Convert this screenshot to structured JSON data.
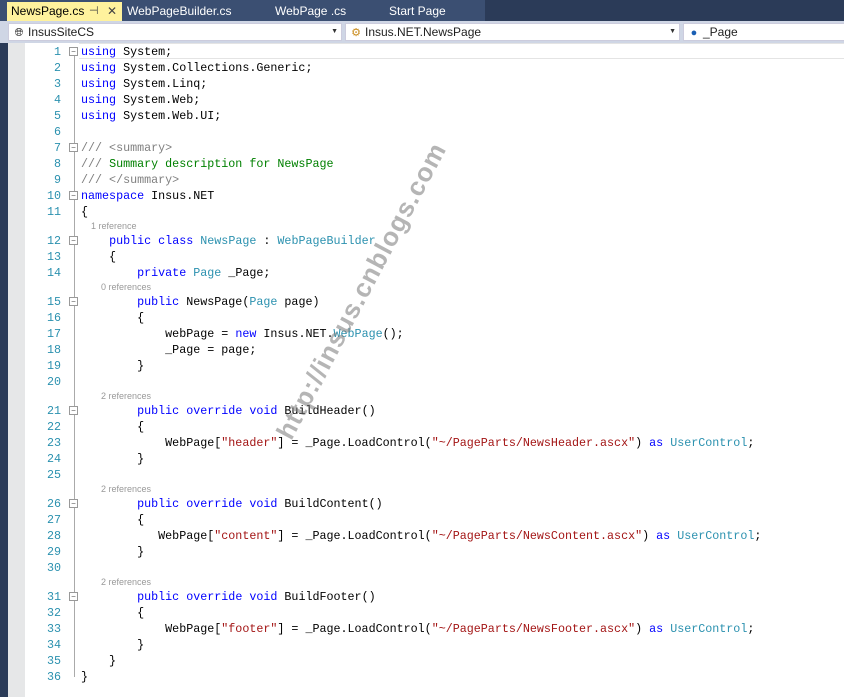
{
  "tabs": [
    {
      "label": "NewsPage.cs",
      "active": true
    },
    {
      "label": "WebPageBuilder.cs"
    },
    {
      "label": "WebPage .cs"
    },
    {
      "label": "Start Page"
    }
  ],
  "tab_pin_icon": "⊣",
  "tab_close_icon": "✕",
  "navbar": {
    "project": "InsusSiteCS",
    "type": "Insus.NET.NewsPage",
    "member": "_Page"
  },
  "watermark": "http://insus.cnblogs.com",
  "colors": {
    "keyword": "#0000ff",
    "type": "#2b91af",
    "string": "#a31515",
    "comment": "#008000",
    "doc": "#808080"
  },
  "lines": [
    {
      "n": "1",
      "fold": true,
      "tokens": [
        [
          "k",
          "using"
        ],
        [
          "p",
          " System;"
        ]
      ]
    },
    {
      "n": "2",
      "tokens": [
        [
          "k",
          "using"
        ],
        [
          "p",
          " System.Collections.Generic;"
        ]
      ]
    },
    {
      "n": "3",
      "tokens": [
        [
          "k",
          "using"
        ],
        [
          "p",
          " System.Linq;"
        ]
      ]
    },
    {
      "n": "4",
      "tokens": [
        [
          "k",
          "using"
        ],
        [
          "p",
          " System.Web;"
        ]
      ]
    },
    {
      "n": "5",
      "tokens": [
        [
          "k",
          "using"
        ],
        [
          "p",
          " System.Web.UI;"
        ]
      ]
    },
    {
      "n": "6",
      "tokens": []
    },
    {
      "n": "7",
      "fold": true,
      "tokens": [
        [
          "d",
          "/// <summary>"
        ]
      ]
    },
    {
      "n": "8",
      "tokens": [
        [
          "d",
          "/// "
        ],
        [
          "c",
          "Summary description for NewsPage"
        ]
      ]
    },
    {
      "n": "9",
      "tokens": [
        [
          "d",
          "/// </summary>"
        ]
      ]
    },
    {
      "n": "10",
      "fold": true,
      "tokens": [
        [
          "k",
          "namespace"
        ],
        [
          "p",
          " Insus.NET"
        ]
      ]
    },
    {
      "n": "11",
      "tokens": [
        [
          "p",
          "{"
        ]
      ]
    },
    {
      "lens": "    1 reference"
    },
    {
      "n": "12",
      "fold": true,
      "tokens": [
        [
          "p",
          "    "
        ],
        [
          "k",
          "public"
        ],
        [
          "p",
          " "
        ],
        [
          "k",
          "class"
        ],
        [
          "p",
          " "
        ],
        [
          "t",
          "NewsPage"
        ],
        [
          "p",
          " : "
        ],
        [
          "t",
          "WebPageBuilder"
        ]
      ]
    },
    {
      "n": "13",
      "tokens": [
        [
          "p",
          "    {"
        ]
      ]
    },
    {
      "n": "14",
      "tokens": [
        [
          "p",
          "        "
        ],
        [
          "k",
          "private"
        ],
        [
          "p",
          " "
        ],
        [
          "t",
          "Page"
        ],
        [
          "p",
          " _Page;"
        ]
      ]
    },
    {
      "lens": "        0 references"
    },
    {
      "n": "15",
      "fold": true,
      "tokens": [
        [
          "p",
          "        "
        ],
        [
          "k",
          "public"
        ],
        [
          "p",
          " NewsPage("
        ],
        [
          "t",
          "Page"
        ],
        [
          "p",
          " page)"
        ]
      ]
    },
    {
      "n": "16",
      "tokens": [
        [
          "p",
          "        {"
        ]
      ]
    },
    {
      "n": "17",
      "tokens": [
        [
          "p",
          "            webPage = "
        ],
        [
          "k",
          "new"
        ],
        [
          "p",
          " Insus.NET."
        ],
        [
          "t",
          "WebPage"
        ],
        [
          "p",
          "();"
        ]
      ]
    },
    {
      "n": "18",
      "tokens": [
        [
          "p",
          "            _Page = page;"
        ]
      ]
    },
    {
      "n": "19",
      "tokens": [
        [
          "p",
          "        }"
        ]
      ]
    },
    {
      "n": "20",
      "tokens": []
    },
    {
      "lens": "        2 references"
    },
    {
      "n": "21",
      "fold": true,
      "tokens": [
        [
          "p",
          "        "
        ],
        [
          "k",
          "public"
        ],
        [
          "p",
          " "
        ],
        [
          "k",
          "override"
        ],
        [
          "p",
          " "
        ],
        [
          "k",
          "void"
        ],
        [
          "p",
          " BuildHeader()"
        ]
      ]
    },
    {
      "n": "22",
      "tokens": [
        [
          "p",
          "        {"
        ]
      ]
    },
    {
      "n": "23",
      "tokens": [
        [
          "p",
          "            WebPage["
        ],
        [
          "s",
          "\"header\""
        ],
        [
          "p",
          "] = _Page.LoadControl("
        ],
        [
          "s",
          "\"~/PageParts/NewsHeader.ascx\""
        ],
        [
          "p",
          ") "
        ],
        [
          "k",
          "as"
        ],
        [
          "p",
          " "
        ],
        [
          "t",
          "UserControl"
        ],
        [
          "p",
          ";"
        ]
      ]
    },
    {
      "n": "24",
      "tokens": [
        [
          "p",
          "        }"
        ]
      ]
    },
    {
      "n": "25",
      "tokens": []
    },
    {
      "lens": "        2 references"
    },
    {
      "n": "26",
      "fold": true,
      "tokens": [
        [
          "p",
          "        "
        ],
        [
          "k",
          "public"
        ],
        [
          "p",
          " "
        ],
        [
          "k",
          "override"
        ],
        [
          "p",
          " "
        ],
        [
          "k",
          "void"
        ],
        [
          "p",
          " BuildContent()"
        ]
      ]
    },
    {
      "n": "27",
      "tokens": [
        [
          "p",
          "        {"
        ]
      ]
    },
    {
      "n": "28",
      "tokens": [
        [
          "p",
          "           WebPage["
        ],
        [
          "s",
          "\"content\""
        ],
        [
          "p",
          "] = _Page.LoadControl("
        ],
        [
          "s",
          "\"~/PageParts/NewsContent.ascx\""
        ],
        [
          "p",
          ") "
        ],
        [
          "k",
          "as"
        ],
        [
          "p",
          " "
        ],
        [
          "t",
          "UserControl"
        ],
        [
          "p",
          ";"
        ]
      ]
    },
    {
      "n": "29",
      "tokens": [
        [
          "p",
          "        }"
        ]
      ]
    },
    {
      "n": "30",
      "tokens": []
    },
    {
      "lens": "        2 references"
    },
    {
      "n": "31",
      "fold": true,
      "tokens": [
        [
          "p",
          "        "
        ],
        [
          "k",
          "public"
        ],
        [
          "p",
          " "
        ],
        [
          "k",
          "override"
        ],
        [
          "p",
          " "
        ],
        [
          "k",
          "void"
        ],
        [
          "p",
          " BuildFooter()"
        ]
      ]
    },
    {
      "n": "32",
      "tokens": [
        [
          "p",
          "        {"
        ]
      ]
    },
    {
      "n": "33",
      "tokens": [
        [
          "p",
          "            WebPage["
        ],
        [
          "s",
          "\"footer\""
        ],
        [
          "p",
          "] = _Page.LoadControl("
        ],
        [
          "s",
          "\"~/PageParts/NewsFooter.ascx\""
        ],
        [
          "p",
          ") "
        ],
        [
          "k",
          "as"
        ],
        [
          "p",
          " "
        ],
        [
          "t",
          "UserControl"
        ],
        [
          "p",
          ";"
        ]
      ]
    },
    {
      "n": "34",
      "tokens": [
        [
          "p",
          "        }"
        ]
      ]
    },
    {
      "n": "35",
      "tokens": [
        [
          "p",
          "    }"
        ]
      ]
    },
    {
      "n": "36",
      "tokens": [
        [
          "p",
          "}"
        ]
      ]
    }
  ]
}
